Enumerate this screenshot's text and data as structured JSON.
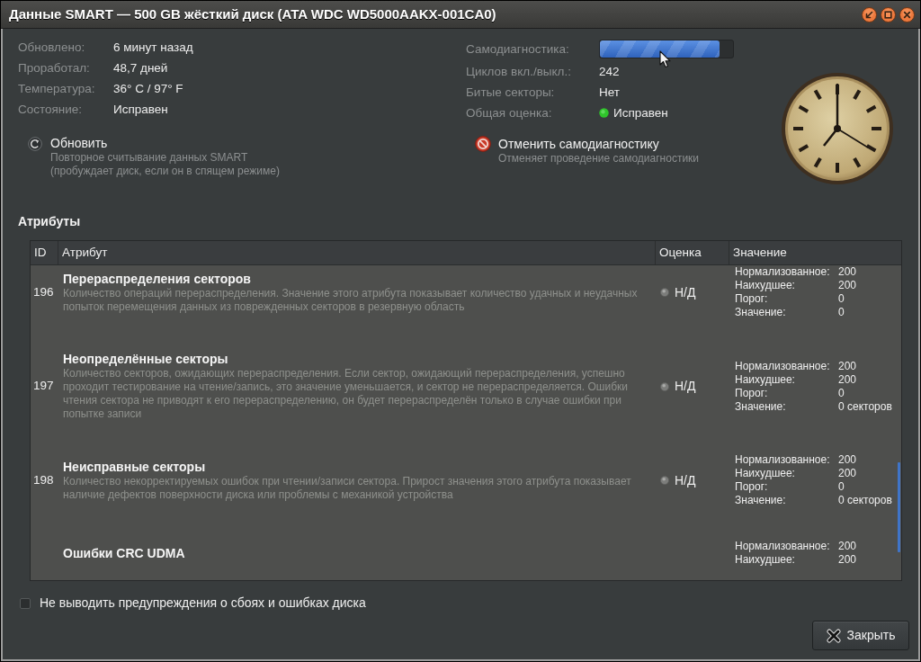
{
  "window": {
    "title": "Данные SMART — 500 GB жёсткий диск (ATA WDC WD5000AAKX-001CA0)",
    "controls": [
      {
        "kind": "minimize"
      },
      {
        "kind": "maximize"
      },
      {
        "kind": "close"
      }
    ]
  },
  "left_panel": {
    "fields": [
      {
        "kind": "text",
        "label": "Обновлено:",
        "value": "6 минут назад"
      },
      {
        "kind": "text",
        "label": "Проработал:",
        "value": "48,7 дней"
      },
      {
        "kind": "text",
        "label": "Температура:",
        "value": "36° C / 97° F"
      },
      {
        "kind": "text",
        "label": "Состояние:",
        "value": "Исправен"
      }
    ],
    "action": {
      "kind": "refresh",
      "title": "Обновить",
      "description": "Повторное считывание данных SMART\n(пробуждает диск, если он в спящем режиме)"
    }
  },
  "right_panel": {
    "fields": [
      {
        "kind": "progress",
        "label": "Самодиагностика:",
        "level": 0.9
      },
      {
        "kind": "text",
        "label": "Циклов вкл./выкл.:",
        "value": "242"
      },
      {
        "kind": "text",
        "label": "Битые секторы:",
        "value": "Нет"
      },
      {
        "kind": "status",
        "label": "Общая оценка:",
        "value": "Исправен"
      }
    ],
    "action": {
      "kind": "cancel",
      "title": "Отменить самодиагностику",
      "description": "Отменяет проведение самодиагностики"
    }
  },
  "attributes": {
    "title": "Атрибуты",
    "columns": [
      "ID",
      "Атрибут",
      "Оценка",
      "Значение"
    ],
    "rows": [
      {
        "id": "196",
        "name": "Перераспределения секторов",
        "description": "Количество операций перераспределения. Значение этого атрибута показывает количество удачных и неудачных попыток перемещения данных из поврежденных секторов в резервную область",
        "assessment": "Н/Д",
        "values": [
          {
            "label": "Нормализованное:",
            "value": "200"
          },
          {
            "label": "Наихудшее:",
            "value": "200"
          },
          {
            "label": "Порог:",
            "value": "0"
          },
          {
            "label": "Значение:",
            "value": "0"
          }
        ]
      },
      {
        "id": "197",
        "name": "Неопределённые секторы",
        "description": "Количество секторов, ожидающих перераспределения. Если сектор, ожидающий перераспределения, успешно проходит тестирование на чтение/запись, это значение уменьшается, и сектор не перераспределяется. Ошибки чтения сектора не приводят к его перераспределению, он будет перераспределён только в случае ошибки при попытке записи",
        "assessment": "Н/Д",
        "values": [
          {
            "label": "Нормализованное:",
            "value": "200"
          },
          {
            "label": "Наихудшее:",
            "value": "200"
          },
          {
            "label": "Порог:",
            "value": "0"
          },
          {
            "label": "Значение:",
            "value": "0 секторов"
          }
        ]
      },
      {
        "id": "198",
        "name": "Неисправные секторы",
        "description": "Количество некорректируемых ошибок при чтении/записи сектора. Прирост значения этого атрибута показывает наличие дефектов поверхности диска или проблемы с механикой устройства",
        "assessment": "Н/Д",
        "values": [
          {
            "label": "Нормализованное:",
            "value": "200"
          },
          {
            "label": "Наихудшее:",
            "value": "200"
          },
          {
            "label": "Порог:",
            "value": "0"
          },
          {
            "label": "Значение:",
            "value": "0 секторов"
          }
        ]
      },
      {
        "name": "Ошибки CRC UDMA",
        "values": [
          {
            "label": "Нормализованное:",
            "value": "200"
          },
          {
            "label": "Наихудшее:",
            "value": "200"
          }
        ]
      }
    ]
  },
  "warning_checkbox": {
    "label": "Не выводить предупреждения о сбоях и ошибках диска",
    "checked": false
  },
  "buttons": [
    {
      "kind": "close",
      "label": "Закрыть"
    }
  ]
}
